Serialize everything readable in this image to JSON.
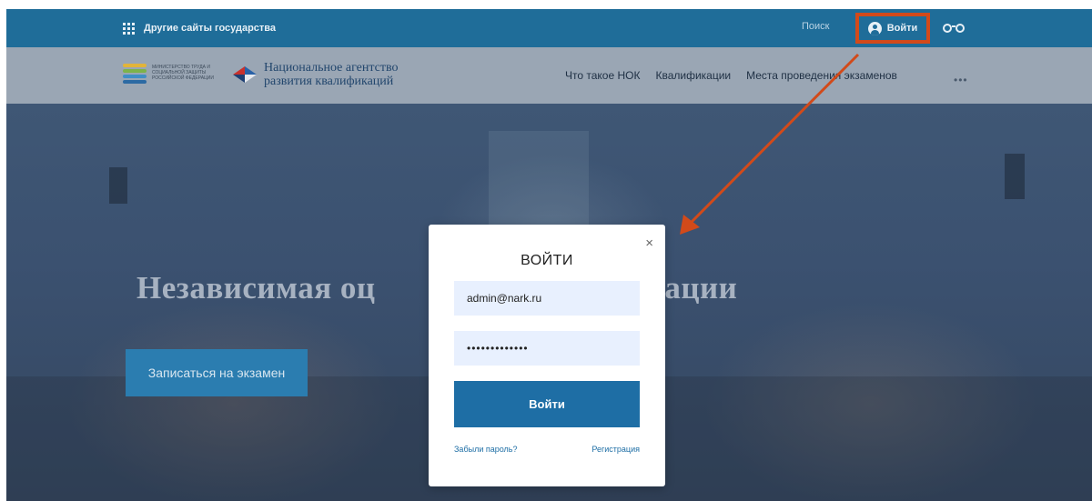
{
  "gov_bar": {
    "other_sites_label": "Другие сайты государства",
    "search_label": "Поиск",
    "login_label": "Войти"
  },
  "nav": {
    "ministry_text": "Министерство труда и социальной защиты Российской Федерации",
    "brand_line1": "Национальное агентство",
    "brand_line2": "развития квалификаций",
    "links": [
      "Что такое НОК",
      "Квалификации",
      "Места проведения экзаменов"
    ],
    "more_label": "•••"
  },
  "hero": {
    "title_left": "Независимая оц",
    "title_right": "икации",
    "exam_button_label": "Записаться на экзамен"
  },
  "modal": {
    "title": "ВОЙТИ",
    "close_label": "×",
    "email_value": "admin@nark.ru",
    "password_value": "•••••••••••••",
    "submit_label": "Войти",
    "forgot_label": "Забыли пароль?",
    "register_label": "Регистрация"
  },
  "colors": {
    "gov_bar": "#1f6d99",
    "highlight": "#d24a1a",
    "submit": "#1e6ea5"
  }
}
